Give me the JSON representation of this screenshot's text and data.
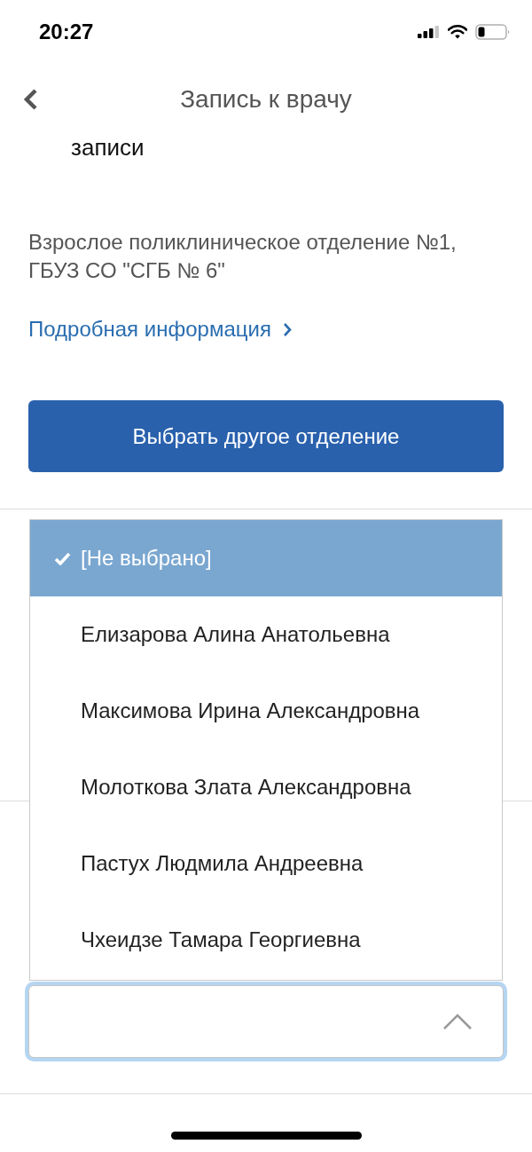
{
  "status_bar": {
    "time": "20:27"
  },
  "nav": {
    "title": "Запись к врачу"
  },
  "section_heading": "записи",
  "department": {
    "name": "Взрослое поликлиническое отделение №1, ГБУЗ СО \"СГБ № 6\"",
    "link": "Подробная информация"
  },
  "button": "Выбрать другое отделение",
  "dropdown": {
    "open": true,
    "options": [
      {
        "label": "[Не выбрано]",
        "selected": true
      },
      {
        "label": "Елизарова Алина Анатольевна",
        "selected": false
      },
      {
        "label": "Максимова Ирина Александровна",
        "selected": false
      },
      {
        "label": "Молоткова Злата Александровна",
        "selected": false
      },
      {
        "label": "Пастух Людмила Андреевна",
        "selected": false
      },
      {
        "label": "Чхеидзе Тамара Георгиевна",
        "selected": false
      }
    ]
  }
}
